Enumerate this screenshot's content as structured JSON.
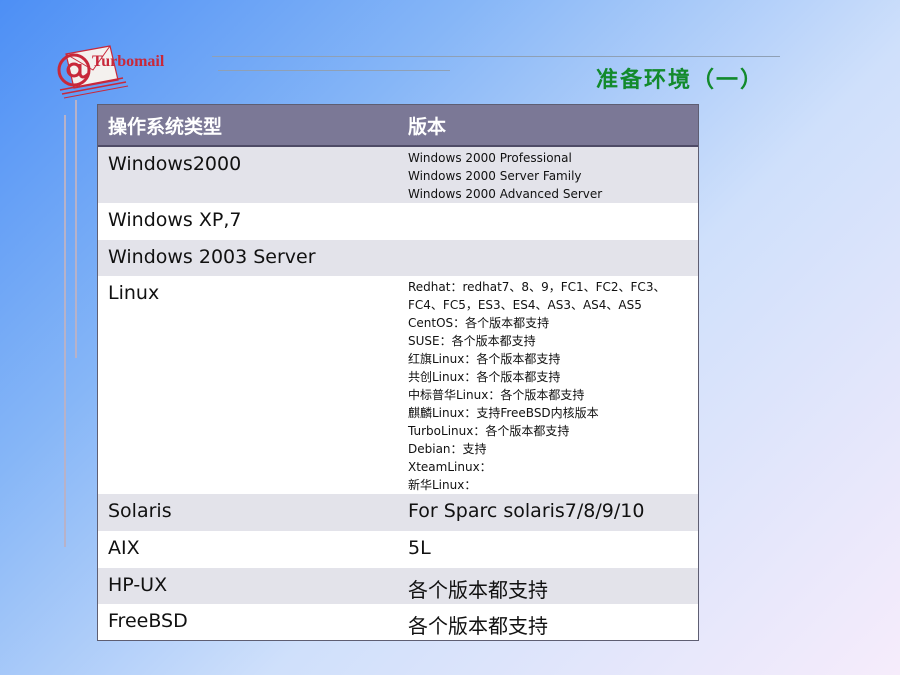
{
  "logo": {
    "text": "Turbomail"
  },
  "title": "准备环境（一）",
  "table": {
    "headers": [
      "操作系统类型",
      "版本"
    ],
    "rows": [
      {
        "os": "Windows2000",
        "versions": [
          "Windows 2000 Professional",
          "Windows 2000 Server Family",
          "Windows 2000 Advanced Server"
        ]
      },
      {
        "os": "Windows XP,7",
        "versions": []
      },
      {
        "os": "Windows 2003 Server",
        "versions": []
      },
      {
        "os": "Linux",
        "versions": [
          "Redhat：redhat7、8、9，FC1、FC2、FC3、FC4、FC5，ES3、ES4、AS3、AS4、AS5",
          "CentOS：各个版本都支持",
          "SUSE：各个版本都支持",
          "红旗Linux：各个版本都支持",
          "共创Linux：各个版本都支持",
          "中标普华Linux：各个版本都支持",
          "麒麟Linux：支持FreeBSD内核版本",
          "TurboLinux：各个版本都支持",
          "Debian：支持",
          "XteamLinux：",
          "新华Linux："
        ]
      },
      {
        "os": "Solaris",
        "versions": [
          "For Sparc solaris7/8/9/10"
        ]
      },
      {
        "os": "AIX",
        "versions": [
          "5L"
        ]
      },
      {
        "os": "HP-UX",
        "versions": [
          "各个版本都支持"
        ]
      },
      {
        "os": "FreeBSD",
        "versions": [
          "各个版本都支持"
        ]
      }
    ]
  },
  "colors": {
    "title": "#128a2c",
    "header_bg": "#7b7896",
    "row_odd": "#e3e3ea",
    "row_even": "#ffffff",
    "logo_red": "#c8283a"
  }
}
